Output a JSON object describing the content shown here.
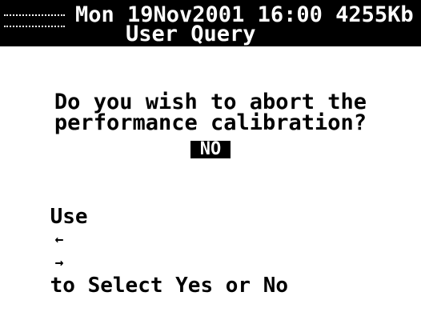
{
  "header": {
    "status": "Mon 19Nov2001 16:00 4255Kb",
    "title": "User Query"
  },
  "dialog": {
    "question_line1": "Do you wish to abort the",
    "question_line2": "performance calibration?",
    "selected_option": "NO"
  },
  "footer": {
    "hint_prefix": "Use",
    "left_arrow": "←",
    "right_arrow": "→",
    "hint_suffix": "to Select Yes or No"
  }
}
